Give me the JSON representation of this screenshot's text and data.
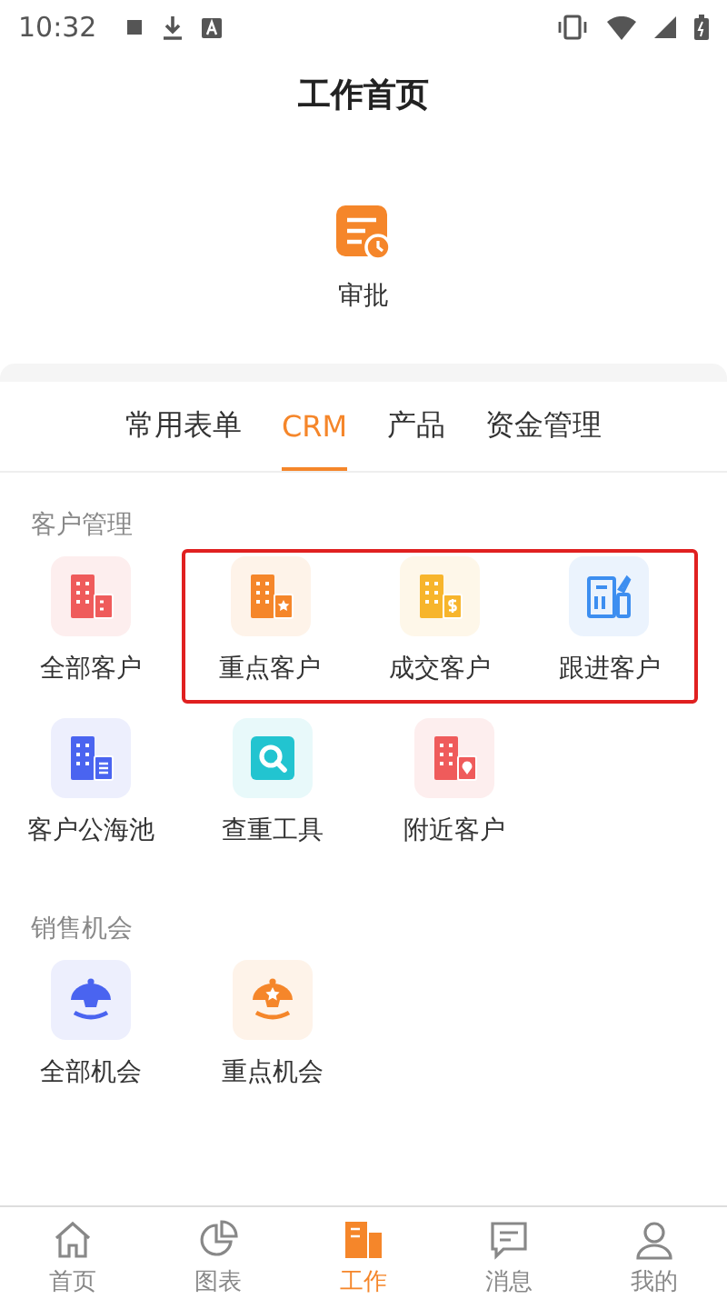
{
  "status_bar": {
    "time": "10:32"
  },
  "header": {
    "title": "工作首页"
  },
  "approval": {
    "label": "审批"
  },
  "tabs": [
    {
      "label": "常用表单",
      "selected": false
    },
    {
      "label": "CRM",
      "selected": true
    },
    {
      "label": "产品",
      "selected": false
    },
    {
      "label": "资金管理",
      "selected": false
    }
  ],
  "sections": [
    {
      "title": "客户管理",
      "rows": [
        [
          {
            "label": "全部客户",
            "color": "#ef5b5b",
            "highlighted": false
          },
          {
            "label": "重点客户",
            "color": "#f5862a",
            "highlighted": true
          },
          {
            "label": "成交客户",
            "color": "#f7b52c",
            "highlighted": true
          },
          {
            "label": "跟进客户",
            "color": "#3d8ef0",
            "highlighted": true
          }
        ],
        [
          {
            "label": "客户公海池",
            "color": "#4a64f0",
            "highlighted": false
          },
          {
            "label": "查重工具",
            "color": "#22c4d0",
            "highlighted": false
          },
          {
            "label": "附近客户",
            "color": "#ef5b5b",
            "highlighted": false
          }
        ]
      ]
    },
    {
      "title": "销售机会",
      "rows": [
        [
          {
            "label": "全部机会",
            "color": "#4a64f0",
            "highlighted": false
          },
          {
            "label": "重点机会",
            "color": "#f5862a",
            "highlighted": false
          }
        ]
      ]
    }
  ],
  "bottom_nav": [
    {
      "label": "首页",
      "selected": false
    },
    {
      "label": "图表",
      "selected": false
    },
    {
      "label": "工作",
      "selected": true
    },
    {
      "label": "消息",
      "selected": false
    },
    {
      "label": "我的",
      "selected": false
    }
  ]
}
